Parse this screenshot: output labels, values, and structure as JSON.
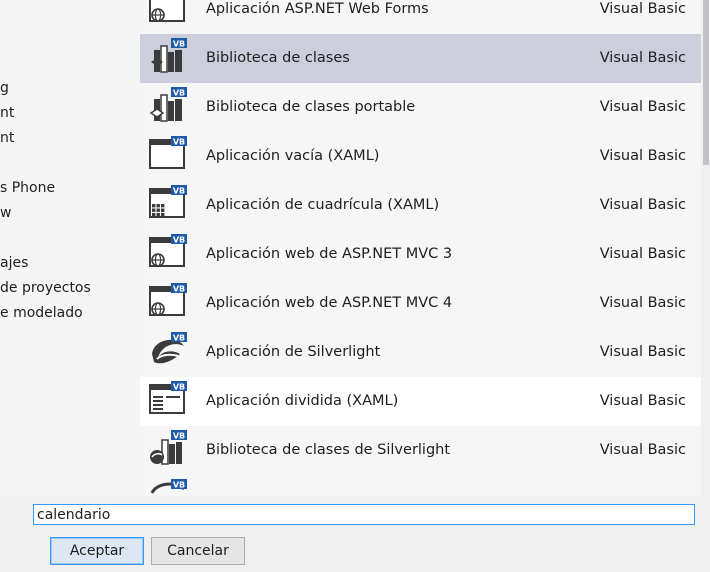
{
  "tree": {
    "items": [
      {
        "label": "g"
      },
      {
        "label": "nt"
      },
      {
        "label": "nt"
      },
      {
        "label": ""
      },
      {
        "label": "s Phone"
      },
      {
        "label": "w"
      },
      {
        "label": ""
      },
      {
        "label": "ajes"
      },
      {
        "label": "de proyectos"
      },
      {
        "label": "e modelado"
      }
    ]
  },
  "templates": [
    {
      "name": "Aplicación ASP.NET Web Forms",
      "language": "Visual Basic",
      "icon": "web-app-icon"
    },
    {
      "name": "Biblioteca de clases",
      "language": "Visual Basic",
      "icon": "class-library-icon"
    },
    {
      "name": "Biblioteca de clases portable",
      "language": "Visual Basic",
      "icon": "portable-class-library-icon"
    },
    {
      "name": "Aplicación vacía (XAML)",
      "language": "Visual Basic",
      "icon": "blank-app-icon"
    },
    {
      "name": "Aplicación de cuadrícula (XAML)",
      "language": "Visual Basic",
      "icon": "grid-app-icon"
    },
    {
      "name": "Aplicación web de ASP.NET MVC 3",
      "language": "Visual Basic",
      "icon": "web-app-icon"
    },
    {
      "name": "Aplicación web de ASP.NET MVC 4",
      "language": "Visual Basic",
      "icon": "web-app-icon"
    },
    {
      "name": "Aplicación de Silverlight",
      "language": "Visual Basic",
      "icon": "silverlight-icon"
    },
    {
      "name": "Aplicación dividida (XAML)",
      "language": "Visual Basic",
      "icon": "split-app-icon"
    },
    {
      "name": "Biblioteca de clases de Silverlight",
      "language": "Visual Basic",
      "icon": "silverlight-library-icon"
    },
    {
      "name": "",
      "language": "",
      "icon": "partial-item-icon"
    }
  ],
  "name_field": {
    "value": "calendario"
  },
  "buttons": {
    "ok": "Aceptar",
    "cancel": "Cancelar"
  },
  "colors": {
    "selected_row": "#cccedb",
    "vb_badge": "#1e5aa8",
    "focus_border": "#3399ff"
  }
}
